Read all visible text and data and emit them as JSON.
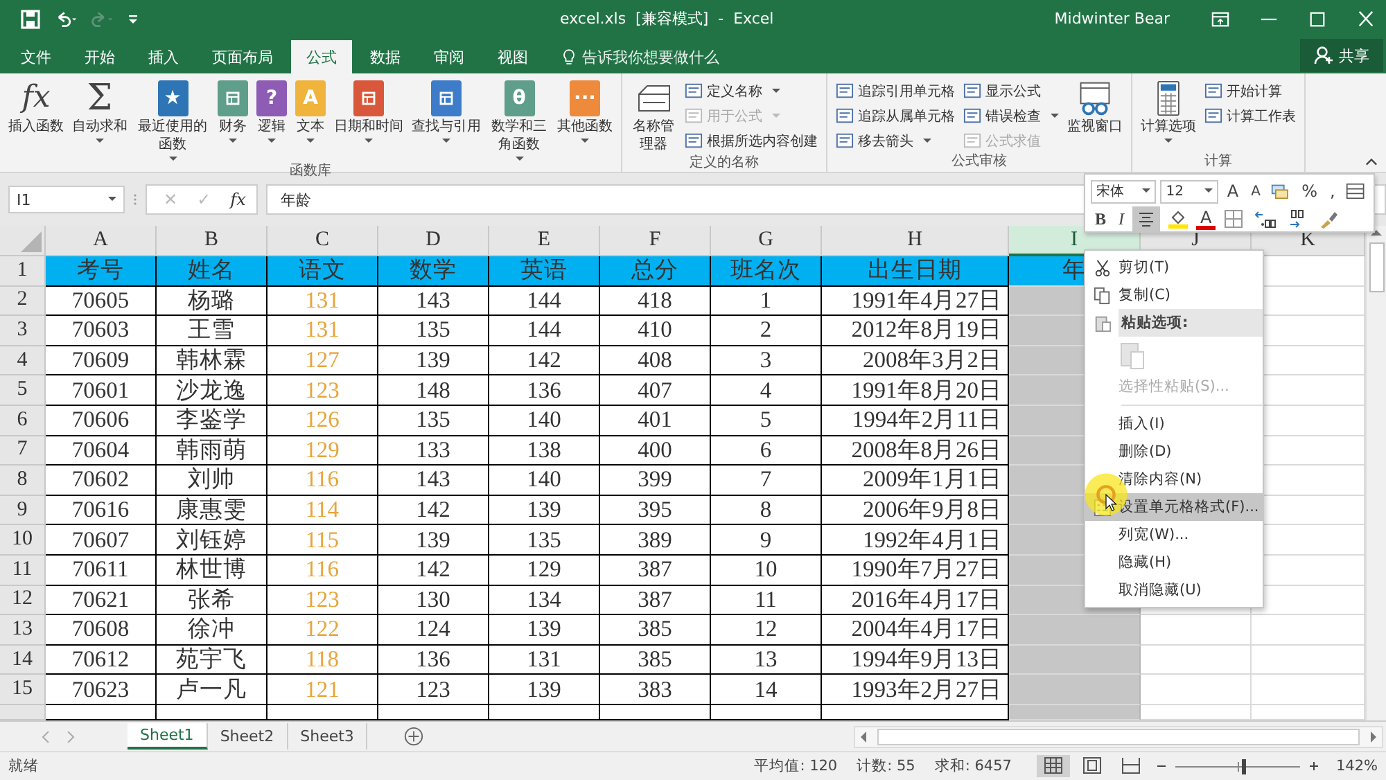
{
  "title_bar": {
    "title": "excel.xls  [兼容模式]  -  Excel",
    "user": "Midwinter Bear",
    "quick_access": [
      {
        "kind": "save",
        "disabled": false
      },
      {
        "kind": "undo",
        "disabled": false
      },
      {
        "kind": "redo",
        "disabled": true
      },
      {
        "kind": "customize",
        "disabled": false
      }
    ]
  },
  "tabs": [
    {
      "label": "文件",
      "selected": false
    },
    {
      "label": "开始",
      "selected": false
    },
    {
      "label": "插入",
      "selected": false
    },
    {
      "label": "页面布局",
      "selected": false
    },
    {
      "label": "公式",
      "selected": true
    },
    {
      "label": "数据",
      "selected": false
    },
    {
      "label": "审阅",
      "selected": false
    },
    {
      "label": "视图",
      "selected": false
    }
  ],
  "tell_me": "告诉我你想要做什么",
  "share": "共享",
  "ribbon": {
    "groups": [
      {
        "label": "函数库",
        "items": [
          {
            "kind": "glyph",
            "glyph": "fx",
            "label": "插入函数",
            "dropdown": false
          },
          {
            "kind": "glyph",
            "glyph": "Σ",
            "label": "自动求和",
            "dropdown": true
          },
          {
            "kind": "book",
            "glyph": "★",
            "color": "#2e75b6",
            "label": "最近使用的函数",
            "dropdown": true
          },
          {
            "kind": "book",
            "color": "#5f9e8a",
            "label": "财务",
            "dropdown": true
          },
          {
            "kind": "book",
            "glyph": "?",
            "color": "#8e5bb5",
            "label": "逻辑",
            "dropdown": true
          },
          {
            "kind": "book",
            "glyph": "A",
            "color": "#f0b43c",
            "label": "文本",
            "dropdown": true
          },
          {
            "kind": "book",
            "color": "#d9583b",
            "label": "日期和时间",
            "dropdown": true
          },
          {
            "kind": "book",
            "color": "#3d7cc9",
            "label": "查找与引用",
            "dropdown": true
          },
          {
            "kind": "book",
            "glyph": "θ",
            "color": "#5f9e8a",
            "label": "数学和三角函数",
            "dropdown": true
          },
          {
            "kind": "book",
            "glyph": "···",
            "color": "#ee8a3c",
            "label": "其他函数",
            "dropdown": true
          }
        ]
      },
      {
        "label": "定义的名称",
        "items": [
          {
            "kind": "names",
            "label": "名称管理器",
            "dropdown": false
          },
          {
            "kind": "stack",
            "items": [
              {
                "label": "定义名称",
                "dropdown": true,
                "disabled": false
              },
              {
                "label": "用于公式",
                "dropdown": true,
                "disabled": true
              },
              {
                "label": "根据所选内容创建",
                "dropdown": false,
                "disabled": false
              }
            ]
          }
        ]
      },
      {
        "label": "公式审核",
        "items": [
          {
            "kind": "stack",
            "items": [
              {
                "label": "追踪引用单元格",
                "dropdown": false,
                "disabled": false
              },
              {
                "label": "追踪从属单元格",
                "dropdown": false,
                "disabled": false
              },
              {
                "label": "移去箭头",
                "dropdown": true,
                "disabled": false
              }
            ]
          },
          {
            "kind": "stack",
            "items": [
              {
                "label": "显示公式",
                "dropdown": false,
                "disabled": false
              },
              {
                "label": "错误检查",
                "dropdown": true,
                "disabled": false
              },
              {
                "label": "公式求值",
                "dropdown": false,
                "disabled": true
              }
            ]
          },
          {
            "kind": "watch",
            "label": "监视窗口",
            "dropdown": false
          }
        ]
      },
      {
        "label": "计算",
        "items": [
          {
            "kind": "calculator",
            "label": "计算选项",
            "dropdown": true
          },
          {
            "kind": "stack",
            "items": [
              {
                "label": "开始计算",
                "dropdown": false,
                "disabled": false
              },
              {
                "label": "计算工作表",
                "dropdown": false,
                "disabled": false
              }
            ]
          }
        ]
      }
    ]
  },
  "formula_bar": {
    "name_box": "I1",
    "cancel": "✕",
    "enter": "✓",
    "fx": "fx",
    "value": "年龄"
  },
  "sheet": {
    "columns": [
      {
        "letter": "A",
        "selected": false,
        "emphasis": false
      },
      {
        "letter": "B",
        "selected": false,
        "emphasis": false
      },
      {
        "letter": "C",
        "selected": false,
        "emphasis": true
      },
      {
        "letter": "D",
        "selected": false,
        "emphasis": false
      },
      {
        "letter": "E",
        "selected": false,
        "emphasis": false
      },
      {
        "letter": "F",
        "selected": false,
        "emphasis": false
      },
      {
        "letter": "G",
        "selected": false,
        "emphasis": false
      },
      {
        "letter": "H",
        "selected": false,
        "emphasis": false
      },
      {
        "letter": "I",
        "selected": true
      },
      {
        "letter": "J",
        "selected": false
      },
      {
        "letter": "K",
        "selected": false
      }
    ],
    "rows": [
      {
        "num": "1",
        "kind": "header",
        "cells": [
          "考号",
          "姓名",
          "语文",
          "数学",
          "英语",
          "总分",
          "班名次",
          "出生日期",
          "年"
        ]
      },
      {
        "num": "2",
        "kind": "data",
        "cells": [
          "70605",
          "杨璐",
          "131",
          "143",
          "144",
          "418",
          "1",
          "1991年4月27日"
        ]
      },
      {
        "num": "3",
        "kind": "data",
        "cells": [
          "70603",
          "王雪",
          "131",
          "135",
          "144",
          "410",
          "2",
          "2012年8月19日"
        ]
      },
      {
        "num": "4",
        "kind": "data",
        "cells": [
          "70609",
          "韩林霖",
          "127",
          "139",
          "142",
          "408",
          "3",
          "2008年3月2日"
        ]
      },
      {
        "num": "5",
        "kind": "data",
        "cells": [
          "70601",
          "沙龙逸",
          "123",
          "148",
          "136",
          "407",
          "4",
          "1991年8月20日"
        ]
      },
      {
        "num": "6",
        "kind": "data",
        "cells": [
          "70606",
          "李鉴学",
          "126",
          "135",
          "140",
          "401",
          "5",
          "1994年2月11日"
        ]
      },
      {
        "num": "7",
        "kind": "data",
        "cells": [
          "70604",
          "韩雨萌",
          "129",
          "133",
          "138",
          "400",
          "6",
          "2008年8月26日"
        ]
      },
      {
        "num": "8",
        "kind": "data",
        "cells": [
          "70602",
          "刘帅",
          "116",
          "143",
          "140",
          "399",
          "7",
          "2009年1月1日"
        ]
      },
      {
        "num": "9",
        "kind": "data",
        "cells": [
          "70616",
          "康惠雯",
          "114",
          "142",
          "139",
          "395",
          "8",
          "2006年9月8日"
        ]
      },
      {
        "num": "10",
        "kind": "data",
        "cells": [
          "70607",
          "刘钰婷",
          "115",
          "139",
          "135",
          "389",
          "9",
          "1992年4月1日"
        ]
      },
      {
        "num": "11",
        "kind": "data",
        "cells": [
          "70611",
          "林世博",
          "116",
          "142",
          "129",
          "387",
          "10",
          "1990年7月27日"
        ]
      },
      {
        "num": "12",
        "kind": "data",
        "cells": [
          "70621",
          "张希",
          "123",
          "130",
          "134",
          "387",
          "11",
          "2016年4月17日"
        ]
      },
      {
        "num": "13",
        "kind": "data",
        "cells": [
          "70608",
          "徐冲",
          "122",
          "124",
          "139",
          "385",
          "12",
          "2004年4月17日"
        ]
      },
      {
        "num": "14",
        "kind": "data",
        "cells": [
          "70612",
          "苑宇飞",
          "118",
          "136",
          "131",
          "385",
          "13",
          "1994年9月13日"
        ]
      },
      {
        "num": "15",
        "kind": "data",
        "cells": [
          "70623",
          "卢一凡",
          "121",
          "123",
          "139",
          "383",
          "14",
          "1993年2月27日"
        ]
      }
    ]
  },
  "mini_toolbar": {
    "font": "宋体",
    "size": "12",
    "row1": [
      {
        "kind": "grow",
        "glyph": "A",
        "pressed": false
      },
      {
        "kind": "shrink",
        "glyph": "A",
        "pressed": false
      },
      {
        "kind": "accounting",
        "pressed": false
      },
      {
        "kind": "glyph",
        "glyph": "%",
        "pressed": false
      },
      {
        "kind": "glyph",
        "glyph": ",",
        "pressed": false
      },
      {
        "kind": "merge",
        "pressed": false
      }
    ],
    "row2": [
      {
        "kind": "glyph",
        "glyph": "B",
        "pressed": false
      },
      {
        "kind": "italic",
        "glyph": "I",
        "pressed": false
      },
      {
        "kind": "align",
        "pressed": true
      },
      {
        "kind": "fill",
        "pressed": false
      },
      {
        "kind": "font-color",
        "glyph": "A",
        "pressed": false
      },
      {
        "kind": "borders",
        "pressed": false
      },
      {
        "kind": "inc-decimal",
        "pressed": false
      },
      {
        "kind": "dec-decimal",
        "pressed": false
      },
      {
        "kind": "painter",
        "pressed": false
      }
    ]
  },
  "context_menu": [
    {
      "kind": "item",
      "label": "剪切(T)",
      "disabled": false,
      "selected": false
    },
    {
      "kind": "item",
      "label": "复制(C)",
      "disabled": false,
      "selected": false
    },
    {
      "kind": "heading",
      "label": "粘贴选项:",
      "disabled": false
    },
    {
      "kind": "paste",
      "disabled": true
    },
    {
      "kind": "item",
      "label": "选择性粘贴(S)...",
      "disabled": true,
      "selected": false
    },
    {
      "kind": "separator"
    },
    {
      "kind": "item",
      "label": "插入(I)",
      "disabled": false,
      "selected": false
    },
    {
      "kind": "item",
      "label": "删除(D)",
      "disabled": false,
      "selected": false
    },
    {
      "kind": "item",
      "label": "清除内容(N)",
      "disabled": false,
      "selected": false
    },
    {
      "kind": "item",
      "label": "设置单元格格式(F)...",
      "disabled": false,
      "selected": true
    },
    {
      "kind": "item",
      "label": "列宽(W)...",
      "disabled": false,
      "selected": false
    },
    {
      "kind": "item",
      "label": "隐藏(H)",
      "disabled": false,
      "selected": false
    },
    {
      "kind": "item",
      "label": "取消隐藏(U)",
      "disabled": false,
      "selected": false
    }
  ],
  "sheet_tabs": [
    {
      "label": "Sheet1",
      "selected": true
    },
    {
      "label": "Sheet2",
      "selected": false
    },
    {
      "label": "Sheet3",
      "selected": false
    }
  ],
  "status_bar": {
    "ready": "就绪",
    "stats": [
      "平均值: 120",
      "计数: 55",
      "求和: 6457"
    ],
    "views": [
      {
        "kind": "normal",
        "selected": true
      },
      {
        "kind": "page-layout",
        "selected": false
      },
      {
        "kind": "page-break",
        "selected": false
      }
    ],
    "zoom": {
      "level": 0.55,
      "label": "142%"
    }
  }
}
